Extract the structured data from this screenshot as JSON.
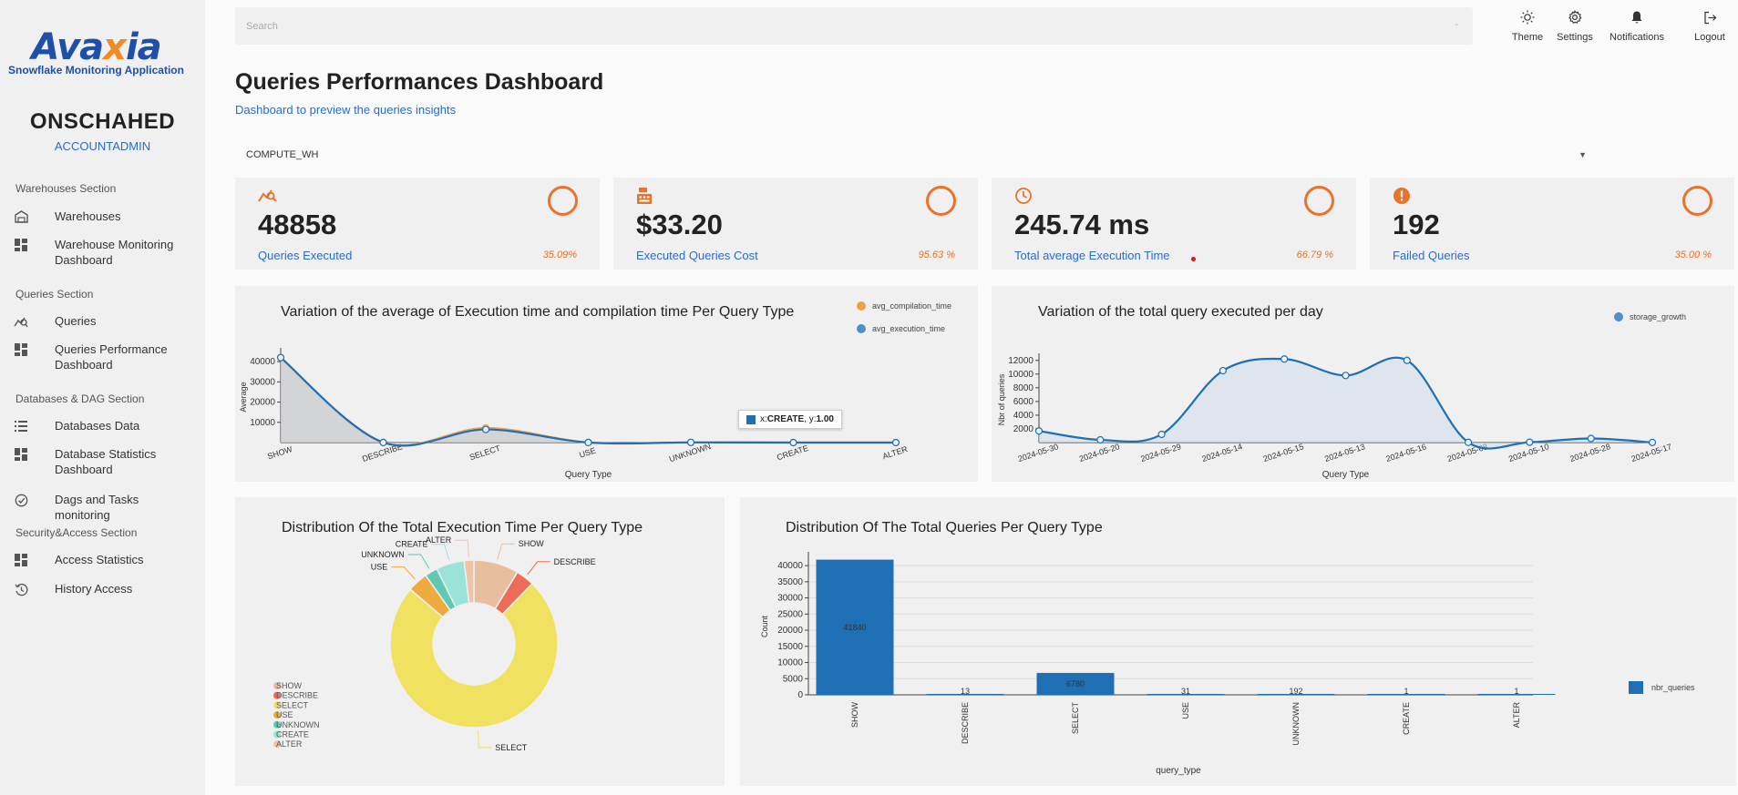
{
  "sidebar": {
    "logo_main_a": "Ava",
    "logo_main_x": "x",
    "logo_main_b": "ia",
    "logo_sub": "Snowflake Monitoring Application",
    "username": "ONSCHAHED",
    "role": "ACCOUNTADMIN",
    "sections": [
      {
        "title": "Warehouses Section"
      },
      {
        "title": "Queries Section"
      },
      {
        "title": "Databases & DAG Section"
      },
      {
        "title": "Security&Access Section"
      }
    ],
    "items": [
      {
        "label": "Warehouses",
        "icon": "warehouse-icon"
      },
      {
        "label": "Warehouse Monitoring Dashboard",
        "icon": "dashboard-icon"
      },
      {
        "label": "Queries",
        "icon": "query-stats-icon"
      },
      {
        "label": "Queries Performance Dashboard",
        "icon": "dashboard-icon"
      },
      {
        "label": "Databases Data",
        "icon": "list-icon"
      },
      {
        "label": "Database Statistics Dashboard",
        "icon": "dashboard-icon"
      },
      {
        "label": "Dags and Tasks monitoring",
        "icon": "check-circle-icon"
      },
      {
        "label": "Access Statistics",
        "icon": "dashboard-icon"
      },
      {
        "label": "History Access",
        "icon": "history-icon"
      }
    ]
  },
  "topbar": {
    "search_placeholder": "Search",
    "search_hint": "-",
    "buttons": [
      {
        "label": "Theme",
        "icon": "sun-icon"
      },
      {
        "label": "Settings",
        "icon": "gear-icon"
      },
      {
        "label": "Notifications",
        "icon": "bell-icon"
      },
      {
        "label": "Logout",
        "icon": "logout-icon"
      }
    ]
  },
  "header": {
    "title": "Queries Performances Dashboard",
    "subtitle": "Dashboard to preview the queries insights"
  },
  "warehouse_select": {
    "value": "COMPUTE_WH",
    "arrow": "▼"
  },
  "kpis": [
    {
      "value": "48858",
      "label": "Queries Executed",
      "pct": "35.09%",
      "icon": "query-stats-icon"
    },
    {
      "value": "$33.20",
      "label": "Executed Queries Cost",
      "pct": "95.63 %",
      "icon": "cash-register-icon"
    },
    {
      "value": "245.74 ms",
      "label": "Total average Execution Time",
      "pct": "66.79 %",
      "icon": "clock-icon"
    },
    {
      "value": "192",
      "label": "Failed Queries",
      "pct": "35.00 %",
      "icon": "alert-icon"
    }
  ],
  "colors": {
    "accent": "#e8732a",
    "link": "#2b6cc4",
    "series_blue": "#1f6fb5",
    "series_orange": "#f0a04b"
  },
  "tooltip": {
    "prefix": "x: ",
    "x": "CREATE",
    "mid": ", y: ",
    "y": "1.00"
  },
  "chart_data": [
    {
      "type": "area",
      "title": "Variation of the average of Execution time and compilation time Per Query Type",
      "xlabel": "Query Type",
      "ylabel": "Average",
      "categories": [
        "SHOW",
        "DESCRIBE",
        "SELECT",
        "USE",
        "UNKNOWN",
        "CREATE",
        "ALTER"
      ],
      "series": [
        {
          "name": "avg_compilation_time",
          "values": [
            42000,
            50,
            7200,
            50,
            80,
            30,
            30
          ]
        },
        {
          "name": "avg_execution_time",
          "values": [
            42000,
            50,
            6500,
            50,
            80,
            1,
            1
          ]
        }
      ],
      "ylim": [
        0,
        45000
      ],
      "yticks": [
        10000,
        20000,
        30000,
        40000
      ],
      "legend": "top-right"
    },
    {
      "type": "area",
      "title": "Variation of the total query executed per day",
      "xlabel": "Query Type",
      "ylabel": "Nbr of queries",
      "categories": [
        "2024-05-30",
        "2024-05-20",
        "2024-05-29",
        "2024-05-14",
        "2024-05-15",
        "2024-05-13",
        "2024-05-16",
        "2024-05-08",
        "2024-05-10",
        "2024-05-28",
        "2024-05-17"
      ],
      "series": [
        {
          "name": "storage_growth",
          "values": [
            1700,
            400,
            1200,
            10500,
            12200,
            9800,
            12000,
            30,
            50,
            600,
            20
          ]
        }
      ],
      "ylim": [
        0,
        12500
      ],
      "yticks": [
        2000,
        4000,
        6000,
        8000,
        10000,
        12000
      ],
      "legend": "top-right"
    },
    {
      "type": "pie",
      "title": "Distribution Of the Total Execution Time Per Query Type",
      "categories": [
        "SHOW",
        "DESCRIBE",
        "SELECT",
        "USE",
        "UNKNOWN",
        "CREATE",
        "ALTER"
      ],
      "values": [
        8.8,
        3.6,
        75.0,
        4.0,
        2.5,
        5.5,
        1.9
      ],
      "colors": [
        "#e8bf9e",
        "#ee6b57",
        "#f0e160",
        "#eeaa3f",
        "#5fc9b4",
        "#9be3d6",
        "#eec4a8"
      ],
      "legend": "bottom-left"
    },
    {
      "type": "bar",
      "title": "Distribution Of The Total Queries Per Query Type",
      "xlabel": "query_type",
      "ylabel": "Count",
      "categories": [
        "SHOW",
        "DESCRIBE",
        "SELECT",
        "USE",
        "UNKNOWN",
        "CREATE",
        "ALTER"
      ],
      "series": [
        {
          "name": "nbr_queries",
          "values": [
            41840,
            13,
            6780,
            31,
            192,
            1,
            1
          ]
        }
      ],
      "data_labels": [
        "41840",
        "13",
        "6780",
        "31",
        "192",
        "1",
        "1"
      ],
      "ylim": [
        0,
        42000
      ],
      "yticks": [
        0,
        5000,
        10000,
        15000,
        20000,
        25000,
        30000,
        35000,
        40000
      ],
      "legend": "right"
    }
  ]
}
